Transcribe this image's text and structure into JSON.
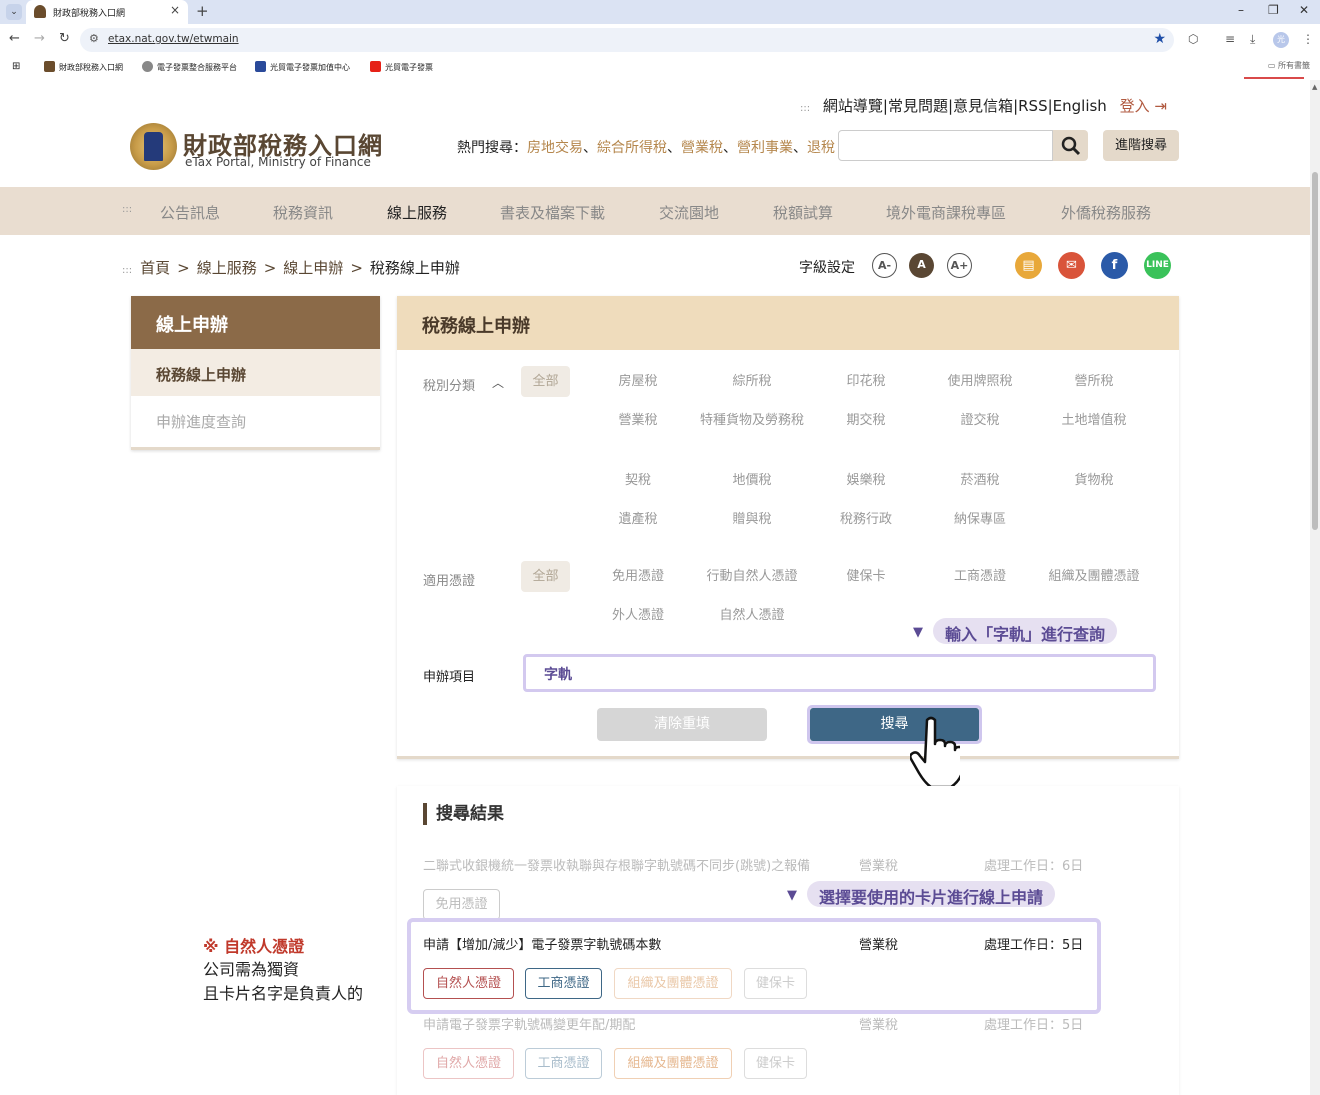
{
  "browser": {
    "tab_title": "財政部稅務入口網",
    "url": "etax.nat.gov.tw/etwmain",
    "avatar_text": "光",
    "bookmarks": [
      {
        "label": "財政部稅務入口網"
      },
      {
        "label": "電子發票整合服務平台"
      },
      {
        "label": "光貿電子發票加值中心"
      },
      {
        "label": "光貿電子發票"
      }
    ],
    "all_bookmarks": "所有書籤"
  },
  "header": {
    "top_links": [
      "網站導覽",
      "常見問題",
      "意見信箱",
      "RSS",
      "English"
    ],
    "login": "登入",
    "logo_title": "財政部稅務入口網",
    "logo_subtitle": "eTax Portal, Ministry of Finance",
    "hot_label": "熱門搜尋：",
    "hot_links": [
      "房地交易",
      "綜合所得稅",
      "營業稅",
      "營利事業",
      "退稅"
    ],
    "adv_search": "進階搜尋"
  },
  "nav": [
    "公告訊息",
    "稅務資訊",
    "線上服務",
    "書表及檔案下載",
    "交流園地",
    "稅額試算",
    "境外電商課稅專區",
    "外僑稅務服務"
  ],
  "breadcrumb": {
    "items": [
      "首頁",
      "線上服務",
      "線上申辦"
    ],
    "current": "稅務線上申辦"
  },
  "font_setting": {
    "label": "字級設定",
    "small": "A-",
    "normal": "A",
    "large": "A+"
  },
  "side": {
    "title": "線上申辦",
    "items": [
      "稅務線上申辦",
      "申辦進度查詢"
    ]
  },
  "panel": {
    "title": "稅務線上申辦",
    "tax_label": "稅別分類",
    "all": "全部",
    "tax_types": [
      "房屋稅",
      "綜所稅",
      "印花稅",
      "使用牌照稅",
      "營所稅",
      "營業稅",
      "特種貨物及勞務稅",
      "期交稅",
      "證交稅",
      "土地增值稅",
      "契稅",
      "地價稅",
      "娛樂稅",
      "菸酒稅",
      "貨物稅",
      "遺產稅",
      "贈與稅",
      "稅務行政",
      "納保專區"
    ],
    "cert_label": "適用憑證",
    "certs": [
      "免用憑證",
      "行動自然人憑證",
      "健保卡",
      "工商憑證",
      "組織及團體憑證",
      "外人憑證",
      "自然人憑證"
    ],
    "item_label": "申辦項目",
    "item_value": "字軌",
    "clear": "清除重填",
    "search": "搜尋"
  },
  "annotations": {
    "a1": "輸入「字軌」進行查詢",
    "a2": "選擇要使用的卡片進行線上申請",
    "note1": "※ 自然人憑證",
    "note2": "公司需為獨資",
    "note3": "且卡片名字是負責人的"
  },
  "results": {
    "title": "搜尋結果",
    "rows": [
      {
        "name": "二聯式收銀機統一發票收執聯與存根聯字軌號碼不同步(跳號)之報備",
        "tax": "營業稅",
        "days": "處理工作日：6日",
        "tags": [
          "免用憑證"
        ]
      },
      {
        "name": "申請【增加/減少】電子發票字軌號碼本數",
        "tax": "營業稅",
        "days": "處理工作日：5日",
        "tags": [
          "自然人憑證",
          "工商憑證",
          "組織及團體憑證",
          "健保卡"
        ]
      },
      {
        "name": "申請電子發票字軌號碼變更年配/期配",
        "tax": "營業稅",
        "days": "處理工作日：5日",
        "tags": [
          "自然人憑證",
          "工商憑證",
          "組織及團體憑證",
          "健保卡"
        ]
      }
    ]
  }
}
